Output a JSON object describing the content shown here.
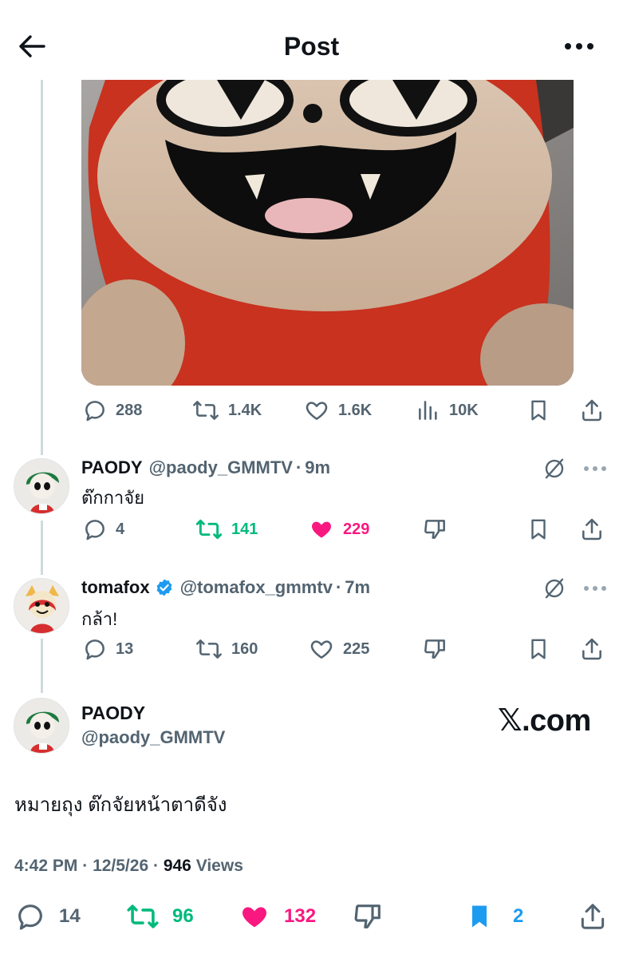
{
  "header": {
    "title": "Post"
  },
  "media": {
    "description": ""
  },
  "post_actions": {
    "replies": "288",
    "reposts": "1.4K",
    "likes": "1.6K",
    "views": "10K"
  },
  "replies": [
    {
      "name": "PAODY",
      "handle": "@paody_GMMTV",
      "separator": "·",
      "time": "9m",
      "text": "ต๊กกาจัย",
      "verified": false,
      "replies": "4",
      "reposts": "141",
      "likes": "229",
      "reposted": true,
      "liked": true
    },
    {
      "name": "tomafox",
      "handle": "@tomafox_gmmtv",
      "separator": "·",
      "time": "7m",
      "text": "กล้า!",
      "verified": true,
      "replies": "13",
      "reposts": "160",
      "likes": "225",
      "reposted": false,
      "liked": false
    }
  ],
  "main_post": {
    "name": "PAODY",
    "handle": "@paody_GMMTV",
    "watermark": "𝕏.com",
    "text": "หมายถุง ต๊กจัยหน้าตาดีจัง",
    "time": "4:42 PM",
    "sep1": "·",
    "date": "12/5/26",
    "sep2": "·",
    "views_count": "946",
    "views_label": "Views",
    "replies": "14",
    "reposts": "96",
    "likes": "132",
    "bookmarks": "2"
  },
  "colors": {
    "text": "#0f1419",
    "secondary": "#536471",
    "repost_green": "#00ba7c",
    "like_pink": "#f91880",
    "bookmark_blue": "#1d9bf0",
    "verified_blue": "#1d9bf0",
    "thread_line": "#cfd9de"
  },
  "icons": [
    "back-arrow-icon",
    "more-icon",
    "reply-icon",
    "repost-icon",
    "like-icon",
    "views-icon",
    "bookmark-icon",
    "share-icon",
    "dislike-icon",
    "grok-icon",
    "verified-badge-icon"
  ]
}
